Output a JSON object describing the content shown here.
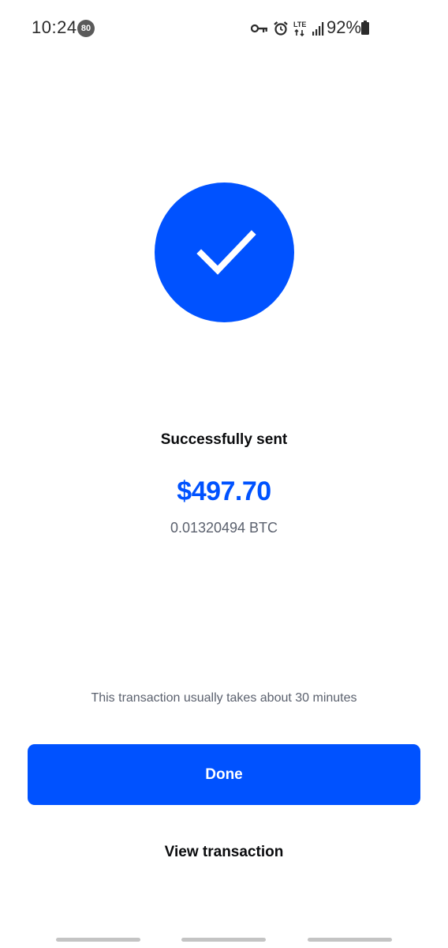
{
  "status_bar": {
    "time": "10:24",
    "notification_count": "80",
    "network": "LTE",
    "battery": "92%",
    "icons": [
      "key-icon",
      "alarm-icon",
      "lte-icon",
      "signal-icon",
      "battery-icon"
    ]
  },
  "success": {
    "icon": "checkmark-icon",
    "title": "Successfully sent",
    "amount": "$497.70",
    "crypto_amount": "0.01320494 BTC"
  },
  "info": {
    "message": "This transaction usually takes about 30 minutes"
  },
  "actions": {
    "done_label": "Done",
    "view_label": "View transaction"
  },
  "colors": {
    "accent": "#0052ff",
    "text_primary": "#0a0b0d",
    "text_secondary": "#5b616e",
    "background": "#ffffff"
  }
}
